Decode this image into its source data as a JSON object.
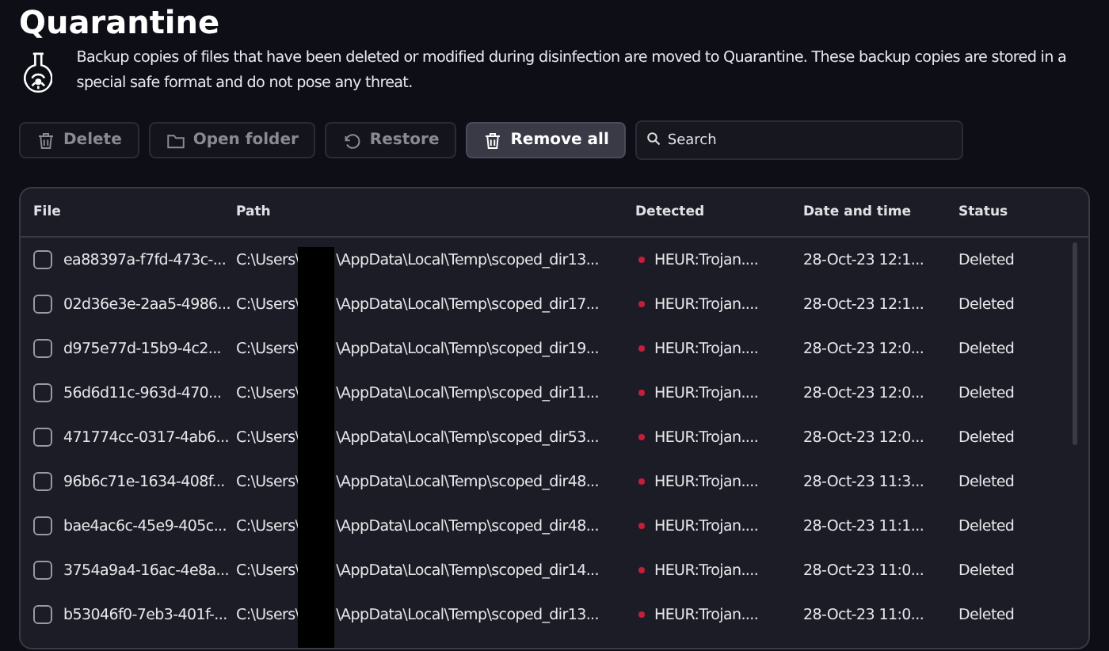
{
  "title": "Quarantine",
  "description": "Backup copies of files that have been deleted or modified during disinfection are moved to Quarantine. These backup copies are stored in a special safe format and do not pose any threat.",
  "toolbar": [
    {
      "kind": "delete",
      "label": "Delete",
      "disabled": true
    },
    {
      "kind": "folder",
      "label": "Open folder",
      "disabled": true
    },
    {
      "kind": "restore",
      "label": "Restore",
      "disabled": true
    },
    {
      "kind": "delete",
      "label": "Remove all",
      "disabled": false
    }
  ],
  "search": {
    "placeholder": "Search"
  },
  "table": {
    "columns": [
      "File",
      "Path",
      "Detected",
      "Date and time",
      "Status"
    ],
    "rows": [
      {
        "checked": false,
        "file": "ea88397a-f7fd-473c-...",
        "path_start": "C:\\Users\\",
        "path_end": "\\AppData\\Local\\Temp\\scoped_dir13...",
        "detected": "HEUR:Trojan....",
        "color": "#c41e3a",
        "date": "28-Oct-23 12:1...",
        "status": "Deleted"
      },
      {
        "checked": false,
        "file": "02d36e3e-2aa5-4986...",
        "path_start": "C:\\Users\\",
        "path_end": "\\AppData\\Local\\Temp\\scoped_dir17...",
        "detected": "HEUR:Trojan....",
        "color": "#c41e3a",
        "date": "28-Oct-23 12:1...",
        "status": "Deleted"
      },
      {
        "checked": false,
        "file": "d975e77d-15b9-4c2...",
        "path_start": "C:\\Users\\",
        "path_end": "\\AppData\\Local\\Temp\\scoped_dir19...",
        "detected": "HEUR:Trojan....",
        "color": "#c41e3a",
        "date": "28-Oct-23 12:0...",
        "status": "Deleted"
      },
      {
        "checked": false,
        "file": "56d6d11c-963d-470...",
        "path_start": "C:\\Users\\",
        "path_end": "\\AppData\\Local\\Temp\\scoped_dir11...",
        "detected": "HEUR:Trojan....",
        "color": "#c41e3a",
        "date": "28-Oct-23 12:0...",
        "status": "Deleted"
      },
      {
        "checked": false,
        "file": "471774cc-0317-4ab6...",
        "path_start": "C:\\Users\\",
        "path_end": "\\AppData\\Local\\Temp\\scoped_dir53...",
        "detected": "HEUR:Trojan....",
        "color": "#c41e3a",
        "date": "28-Oct-23 12:0...",
        "status": "Deleted"
      },
      {
        "checked": false,
        "file": "96b6c71e-1634-408f...",
        "path_start": "C:\\Users\\",
        "path_end": "\\AppData\\Local\\Temp\\scoped_dir48...",
        "detected": "HEUR:Trojan....",
        "color": "#c41e3a",
        "date": "28-Oct-23 11:3...",
        "status": "Deleted"
      },
      {
        "checked": false,
        "file": "bae4ac6c-45e9-405c...",
        "path_start": "C:\\Users\\",
        "path_end": "\\AppData\\Local\\Temp\\scoped_dir48...",
        "detected": "HEUR:Trojan....",
        "color": "#c41e3a",
        "date": "28-Oct-23 11:1...",
        "status": "Deleted"
      },
      {
        "checked": false,
        "file": "3754a9a4-16ac-4e8a...",
        "path_start": "C:\\Users\\",
        "path_end": "\\AppData\\Local\\Temp\\scoped_dir14...",
        "detected": "HEUR:Trojan....",
        "color": "#c41e3a",
        "date": "28-Oct-23 11:0...",
        "status": "Deleted"
      },
      {
        "checked": false,
        "file": "b53046f0-7eb3-401f-...",
        "path_start": "C:\\Users\\",
        "path_end": "\\AppData\\Local\\Temp\\scoped_dir13...",
        "detected": "HEUR:Trojan....",
        "color": "#c41e3a",
        "date": "28-Oct-23 11:0...",
        "status": "Deleted"
      }
    ]
  }
}
